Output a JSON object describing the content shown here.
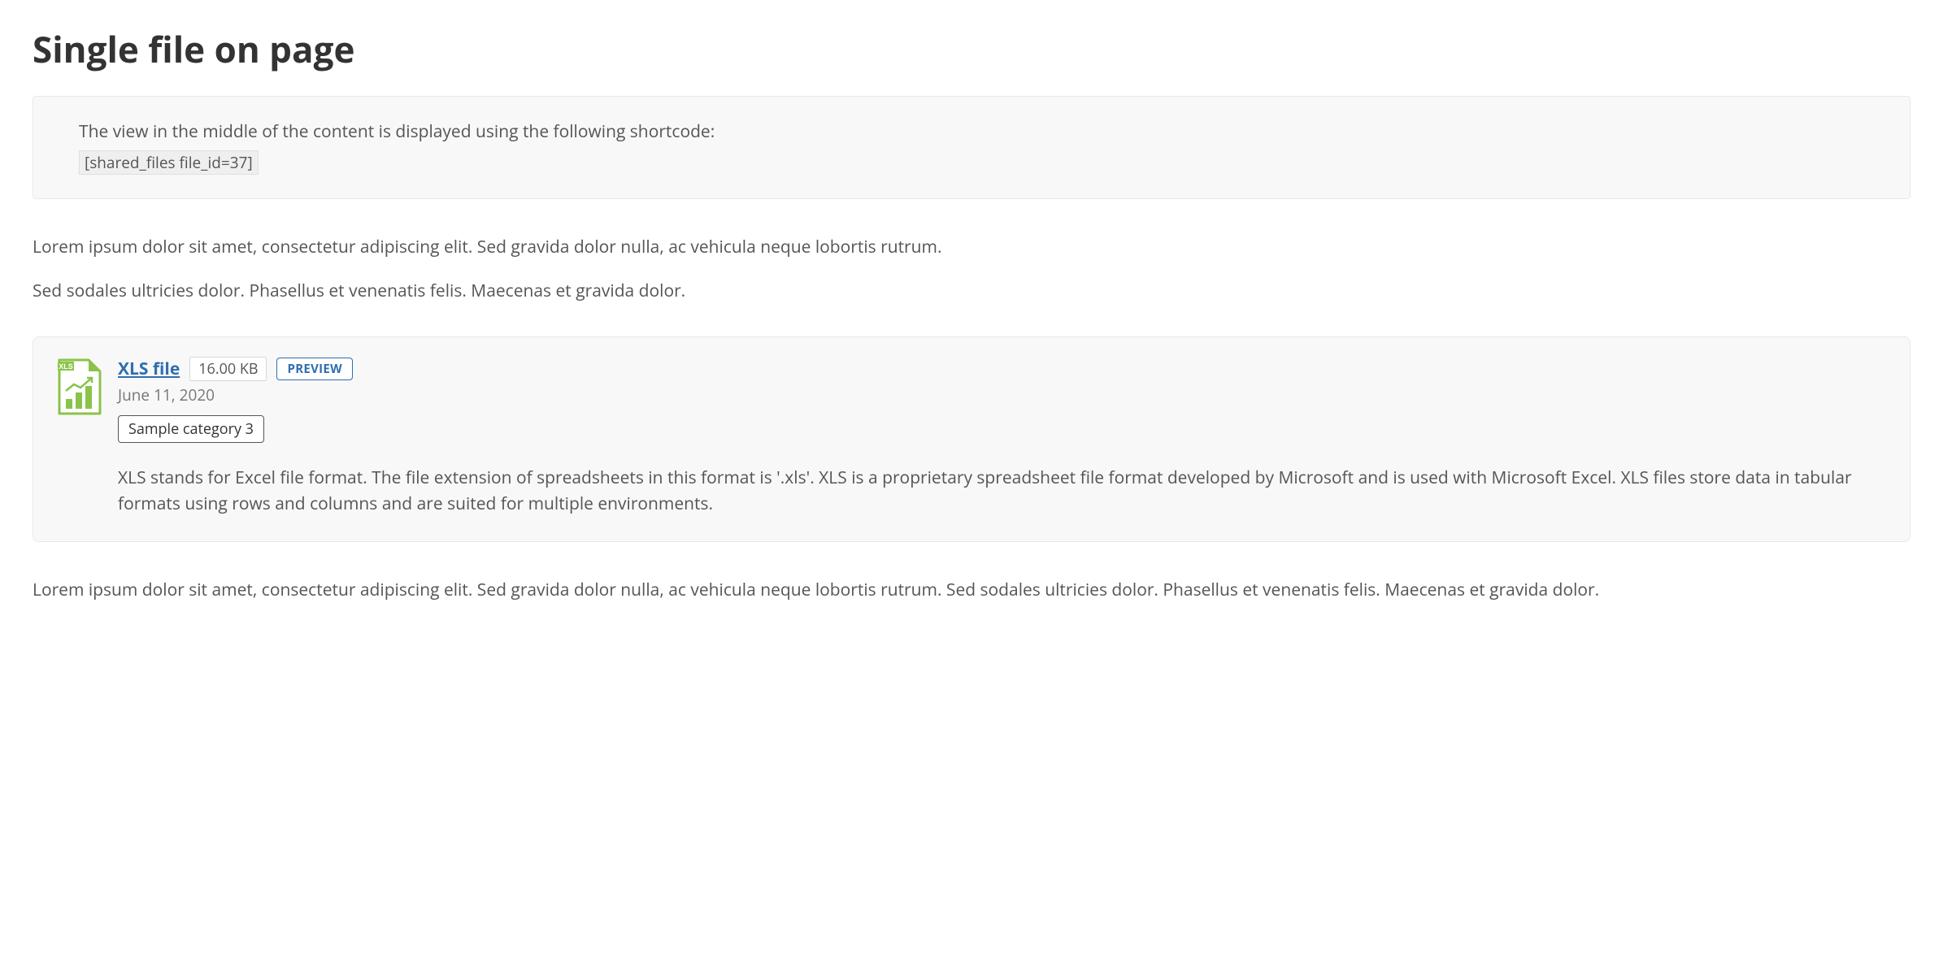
{
  "page": {
    "title": "Single file on page"
  },
  "notice": {
    "intro": "The view in the middle of the content is displayed using the following shortcode:",
    "shortcode": "[shared_files file_id=37]"
  },
  "content": {
    "para_before_1": "Lorem ipsum dolor sit amet, consectetur adipiscing elit. Sed gravida dolor nulla, ac vehicula neque lobortis rutrum.",
    "para_before_2": "Sed sodales ultricies dolor. Phasellus et venenatis felis. Maecenas et gravida dolor.",
    "para_after": "Lorem ipsum dolor sit amet, consectetur adipiscing elit. Sed gravida dolor nulla, ac vehicula neque lobortis rutrum. Sed sodales ultricies dolor. Phasellus et venenatis felis. Maecenas et gravida dolor."
  },
  "file": {
    "icon_label": "XLS",
    "name": "XLS file",
    "size": "16.00 KB",
    "preview_label": "PREVIEW",
    "date": "June 11, 2020",
    "category": "Sample category 3",
    "description": "XLS stands for Excel file format. The file extension of spreadsheets in this format is '.xls'. XLS is a proprietary spreadsheet file format developed by Microsoft and is used with Microsoft Excel. XLS files store data in tabular formats using rows and columns and are suited for multiple environments."
  }
}
